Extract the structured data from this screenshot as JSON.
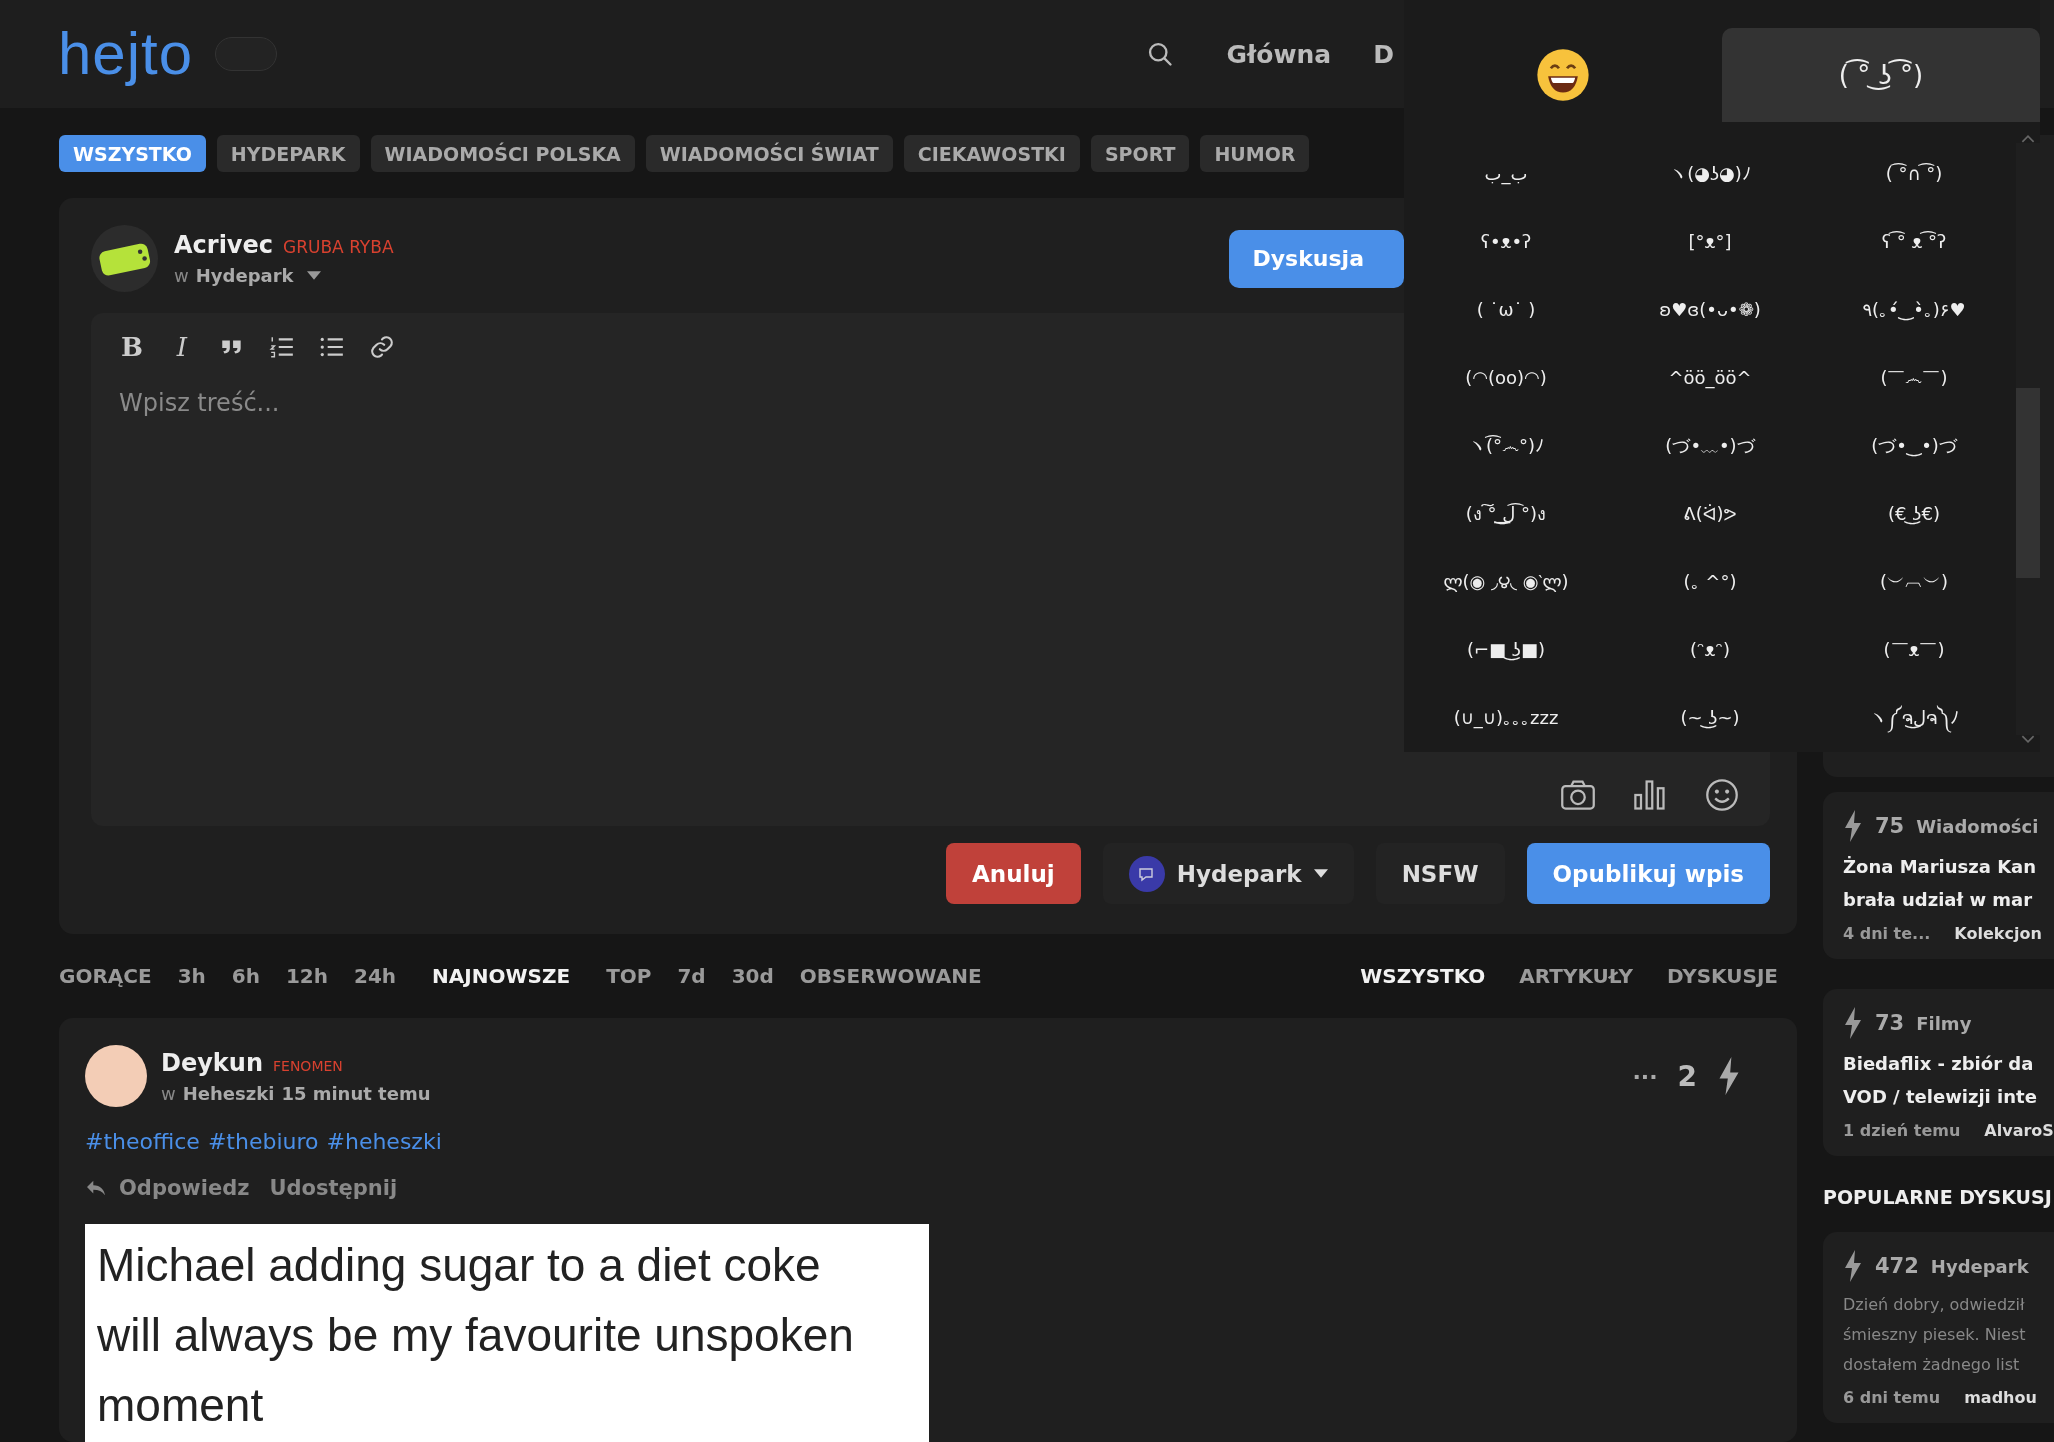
{
  "header": {
    "logo": "hejto",
    "dark_mode": true,
    "nav": [
      "Główna",
      "D"
    ]
  },
  "categories": [
    {
      "label": "WSZYSTKO",
      "selected": true
    },
    {
      "label": "HYDEPARK",
      "selected": false
    },
    {
      "label": "WIADOMOŚCI POLSKA",
      "selected": false
    },
    {
      "label": "WIADOMOŚCI ŚWIAT",
      "selected": false
    },
    {
      "label": "CIEKAWOSTKI",
      "selected": false
    },
    {
      "label": "SPORT",
      "selected": false
    },
    {
      "label": "HUMOR",
      "selected": false
    }
  ],
  "composer": {
    "author": "Acrivec",
    "rank": "GRUBA RYBA",
    "community_prefix": "w",
    "community": "Hydepark",
    "type_button": "Dyskusja",
    "toolbar": [
      {
        "kind": "bold",
        "label": "B"
      },
      {
        "kind": "italic",
        "label": "I"
      },
      {
        "kind": "quote"
      },
      {
        "kind": "ordered_list"
      },
      {
        "kind": "bullet_list"
      },
      {
        "kind": "link"
      }
    ],
    "placeholder": "Wpisz treść...",
    "attachments": [
      {
        "kind": "photo"
      },
      {
        "kind": "poll"
      },
      {
        "kind": "emoji"
      }
    ],
    "cancel": "Anuluj",
    "community_select": "Hydepark",
    "nsfw": "NSFW",
    "publish": "Opublikuj wpis"
  },
  "sort_tabs": [
    {
      "label": "GORĄCE",
      "selected": false
    },
    {
      "label": "3h",
      "selected": false
    },
    {
      "label": "6h",
      "selected": false
    },
    {
      "label": "12h",
      "selected": false
    },
    {
      "label": "24h",
      "selected": false
    },
    {
      "label": "NAJNOWSZE",
      "selected": true
    },
    {
      "label": "TOP",
      "selected": false
    },
    {
      "label": "7d",
      "selected": false
    },
    {
      "label": "30d",
      "selected": false
    },
    {
      "label": "OBSERWOWANE",
      "selected": false
    }
  ],
  "type_tabs": [
    {
      "label": "WSZYSTKO",
      "selected": true
    },
    {
      "label": "ARTYKUŁY",
      "selected": false
    },
    {
      "label": "DYSKUSJE",
      "selected": false
    }
  ],
  "post": {
    "author": "Deykun",
    "rank": "FENOMEN",
    "community_prefix": "w",
    "community": "Heheszki",
    "time": "15 minut temu",
    "menu": "···",
    "score": "2",
    "tags": [
      "#theoffice",
      "#thebiuro",
      "#heheszki"
    ],
    "actions": [
      "Odpowiedz",
      "Udostępnij"
    ],
    "image_text": "Michael adding sugar to a diet coke will always be my favourite unspoken moment"
  },
  "sidebar": {
    "cards": [
      {
        "kind": "link",
        "score": "75",
        "category": "Wiadomości",
        "title_lines": [
          "Żona Mariusza Kan",
          "brała udział w mar"
        ],
        "time": "4 dni te...",
        "author": "Kolekcjon"
      },
      {
        "kind": "link",
        "score": "73",
        "category": "Filmy",
        "title_lines": [
          "Biedaflix - zbiór da",
          "VOD / telewizji inte"
        ],
        "time": "1 dzień temu",
        "author": "AlvaroS"
      }
    ],
    "popular_heading": "POPULARNE DYSKUSJ",
    "popular": [
      {
        "kind": "discussion",
        "score": "472",
        "category": "Hydepark",
        "title_lines": [
          "Dzień dobry, odwiedził",
          "śmieszny piesek. Niest",
          "dostałem żadnego list"
        ],
        "time": "6 dni temu",
        "author": "madhou"
      }
    ]
  },
  "emoji_picker": {
    "tabs": [
      {
        "kind": "emoji",
        "selected": false
      },
      {
        "kind": "kaomoji",
        "label": "( ͡° ͜ʖ ͡°)",
        "selected": true
      }
    ],
    "items": [
      "ب_ب",
      "ヽ(◕ʖ◕)ﾉ",
      "( ͡°∩ ͡°)",
      "ʕ•ᴥ•ʔ",
      "[°ᴥ°]",
      "ʕ ͡° ᴥ ͡°ʔ",
      "( ˙ω˙ )",
      "ʚ♥ɞ(•ᴗ•❁)",
      "٩(｡•́‿•̀｡)۶♥",
      "(◠(oo)◠)",
      "^öö_öö^",
      "(￣෴￣)",
      "ヽ(͡°෴°)ﾉ",
      "(づ•﹏•)づ",
      "(づ•‿•)づ",
      "(ง ͠° ͟ل͜ ͡°)ง",
      "ᕕ(ᐛ)ᕗ",
      "(€ ͜ʖ€)",
      "ლ(◉ ◞౪◟ ◉‵ლ)",
      "(｡ ^°)",
      "(︶︹︶)",
      "(⌐■ ͜ʖ■)",
      "(ᵔᴥᵔ)",
      "(￣ᴥ￣)",
      "(∪_∪)｡｡｡zzz",
      "(~ ͜ʖ~)",
      "ヽ༼ຈل͜ຈ༽ﾉ"
    ]
  }
}
